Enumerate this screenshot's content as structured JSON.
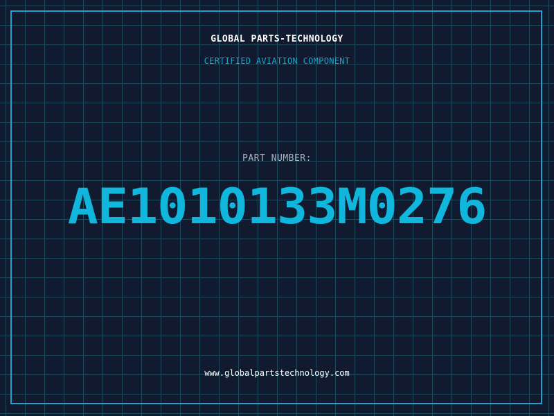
{
  "header": {
    "company": "GLOBAL PARTS-TECHNOLOGY",
    "subtitle": "CERTIFIED AVIATION COMPONENT"
  },
  "part": {
    "label": "PART NUMBER:",
    "number": "AE1010133M0276"
  },
  "footer": {
    "website": "www.globalpartstechnology.com"
  },
  "colors": {
    "background": "#111a2e",
    "grid": "#1e4a5e",
    "accent": "#1aa5cc",
    "part_number": "#10b6db",
    "text": "#ffffff",
    "muted": "#aab3c0"
  }
}
